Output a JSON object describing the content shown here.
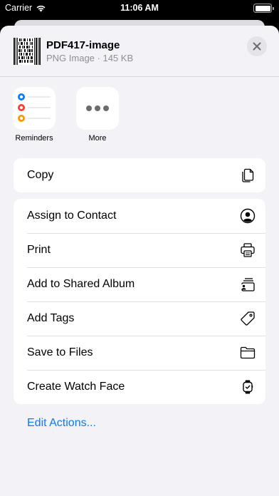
{
  "status_bar": {
    "carrier": "Carrier",
    "time": "11:06 AM"
  },
  "header": {
    "file_name": "PDF417-image",
    "file_info": "PNG Image · 145 KB"
  },
  "apps": [
    {
      "label": "Reminders",
      "icon": "reminders-icon"
    },
    {
      "label": "More",
      "icon": "more-icon"
    }
  ],
  "actions_primary": [
    {
      "label": "Copy",
      "icon": "copy-icon"
    }
  ],
  "actions_secondary": [
    {
      "label": "Assign to Contact",
      "icon": "person-circle-icon"
    },
    {
      "label": "Print",
      "icon": "printer-icon"
    },
    {
      "label": "Add to Shared Album",
      "icon": "shared-album-icon"
    },
    {
      "label": "Add Tags",
      "icon": "tag-icon"
    },
    {
      "label": "Save to Files",
      "icon": "folder-icon"
    },
    {
      "label": "Create Watch Face",
      "icon": "watch-icon"
    }
  ],
  "footer": {
    "edit_actions": "Edit Actions..."
  },
  "colors": {
    "accent": "#0a7aff",
    "sheet_bg": "#f2f2f7",
    "reminder_blue": "#0a7aff",
    "reminder_red": "#ff3b30",
    "reminder_orange": "#ff9500"
  }
}
